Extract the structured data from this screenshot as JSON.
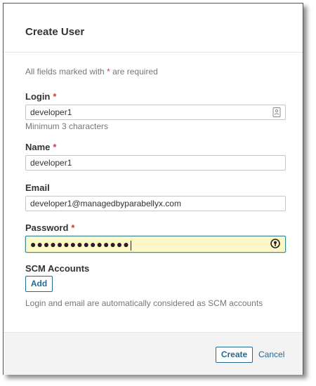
{
  "dialog": {
    "title": "Create User",
    "required_note_prefix": "All fields marked with",
    "required_star": "*",
    "required_note_suffix": "are required"
  },
  "fields": {
    "login": {
      "label": "Login",
      "value": "developer1",
      "hint": "Minimum 3 characters",
      "required": true
    },
    "name": {
      "label": "Name",
      "value": "developer1",
      "required": true
    },
    "email": {
      "label": "Email",
      "value": "developer1@managedbyparabellyx.com",
      "required": false
    },
    "password": {
      "label": "Password",
      "masked_value": "●●●●●●●●●●●●●●●",
      "required": true
    }
  },
  "scm": {
    "label": "SCM Accounts",
    "add_button": "Add",
    "note": "Login and email are automatically considered as SCM accounts"
  },
  "footer": {
    "create_button": "Create",
    "cancel_link": "Cancel"
  },
  "colors": {
    "required_star": "#d4333f",
    "link": "#236a97",
    "focused_input_bg": "#fdf8c5",
    "focused_input_border": "#3d8c9e"
  },
  "icons": {
    "login_field": "contact-card-icon",
    "password_field": "password-manager-icon"
  }
}
